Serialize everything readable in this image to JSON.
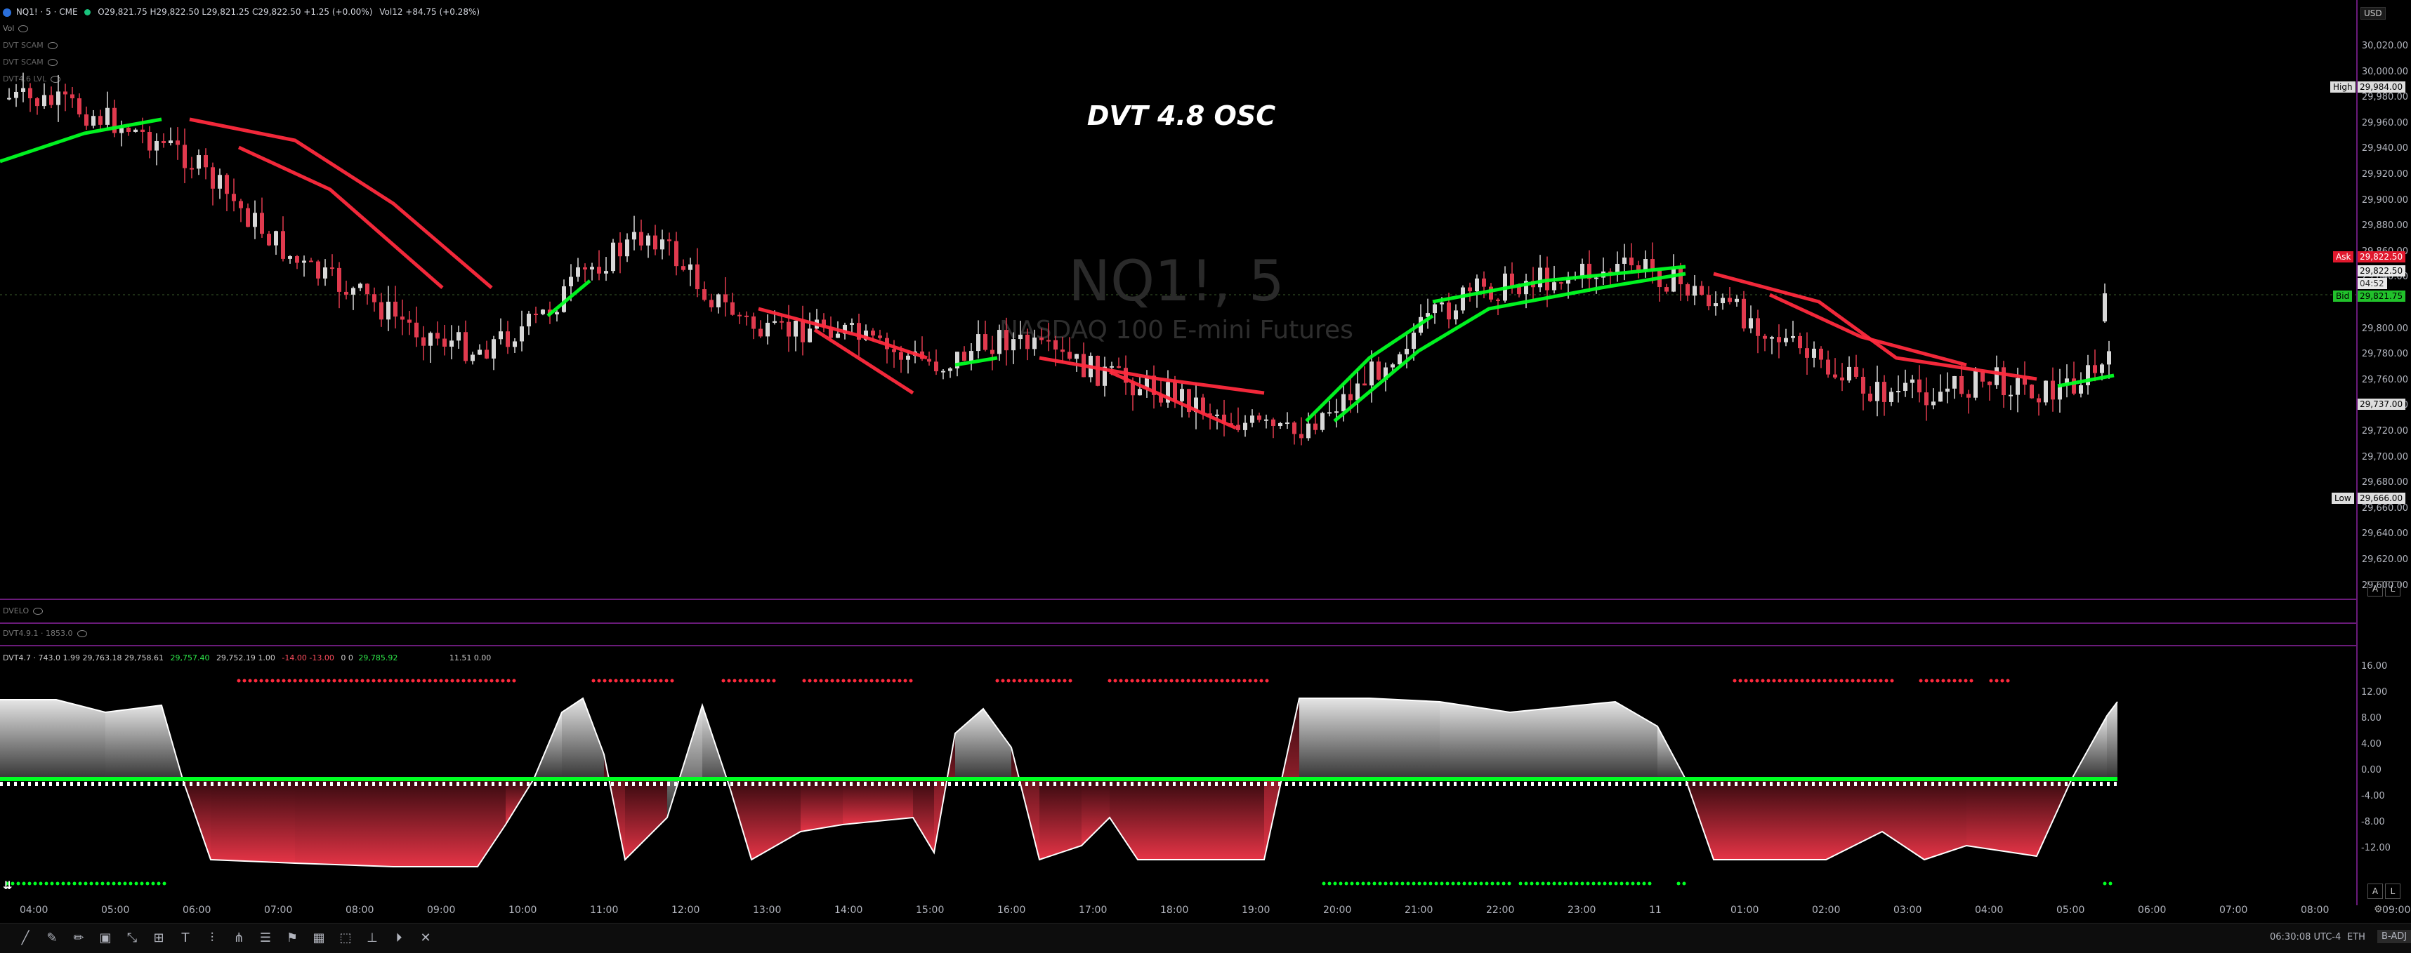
{
  "header": {
    "symbol": "NQ1! · 5 · CME",
    "ohlc": "O29,821.75 H29,822.50 L29,821.25 C29,822.50 +1.25 (+0.00%)",
    "vol": "Vol12 +84.75 (+0.28%)",
    "indicators": [
      "Vol",
      "DVT SCAM",
      "DVT SCAM",
      "DVT4.6 LVL"
    ]
  },
  "watermark": {
    "title": "NQ1!, 5",
    "subtitle": "NASDAQ 100 E-mini Futures"
  },
  "chart_title": "DVT 4.8 OSC",
  "right_axis": {
    "currency": "USD",
    "ticks": [
      "30,020.00",
      "30,000.00",
      "29,980.00",
      "29,960.00",
      "29,940.00",
      "29,920.00",
      "29,900.00",
      "29,880.00",
      "29,860.00",
      "29,840.00",
      "29,822.50",
      "29,800.00",
      "29,780.00",
      "29,760.00",
      "29,740.00",
      "29,720.00",
      "29,700.00",
      "29,680.00",
      "29,660.00",
      "29,640.00",
      "29,620.00",
      "29,600.00"
    ],
    "high_label": "High",
    "high_value": "29,984.00",
    "ask_label": "Ask",
    "ask_value": "29,822.50",
    "last_value": "29,822.50",
    "countdown": "04:52",
    "bid_label": "Bid",
    "bid_value": "29,821.75",
    "level_value": "29,737.00",
    "low_label": "Low",
    "low_value": "29,666.00"
  },
  "panes": {
    "velo": "DVELO",
    "dvt491": "DVT4.9.1 · 1853.0",
    "osc_legend": "DVT4.7 · 743.0 1.99 29,763.18 29,758.61",
    "osc_green": "29,757.40",
    "osc_mid": "29,752.19 1.00",
    "osc_red": "-14.00 -13.00",
    "osc_zero": "0 0",
    "osc_green2": "29,785.92",
    "osc_extra": "11.51 0.00"
  },
  "osc_axis": [
    "16.00",
    "12.00",
    "8.00",
    "4.00",
    "0.00",
    "-4.00",
    "-8.00",
    "-12.00"
  ],
  "time_axis": [
    "04:00",
    "05:00",
    "06:00",
    "07:00",
    "08:00",
    "09:00",
    "10:00",
    "11:00",
    "12:00",
    "13:00",
    "14:00",
    "15:00",
    "16:00",
    "17:00",
    "18:00",
    "19:00",
    "20:00",
    "21:00",
    "22:00",
    "23:00",
    "11",
    "01:00",
    "02:00",
    "03:00",
    "04:00",
    "05:00",
    "06:00",
    "07:00",
    "08:00",
    "09:00"
  ],
  "status": {
    "clock": "06:30:08 UTC-4",
    "session": "ETH",
    "adj": "B-ADJ"
  },
  "colors": {
    "bull": "#00ff22",
    "bear": "#ff2a3d",
    "candle_bear": "#e03a4e",
    "candle_bull": "#d8d8d8",
    "separator": "#6a1b7a"
  },
  "icons": [
    "trend-line-icon",
    "brush-icon",
    "pencil-icon",
    "image-icon",
    "path-icon",
    "grid-icon",
    "text-icon",
    "fib-icon",
    "fork-icon",
    "list-icon",
    "flag-icon",
    "table-icon",
    "frame-icon",
    "measure-icon",
    "replay-icon",
    "close-icon"
  ]
}
